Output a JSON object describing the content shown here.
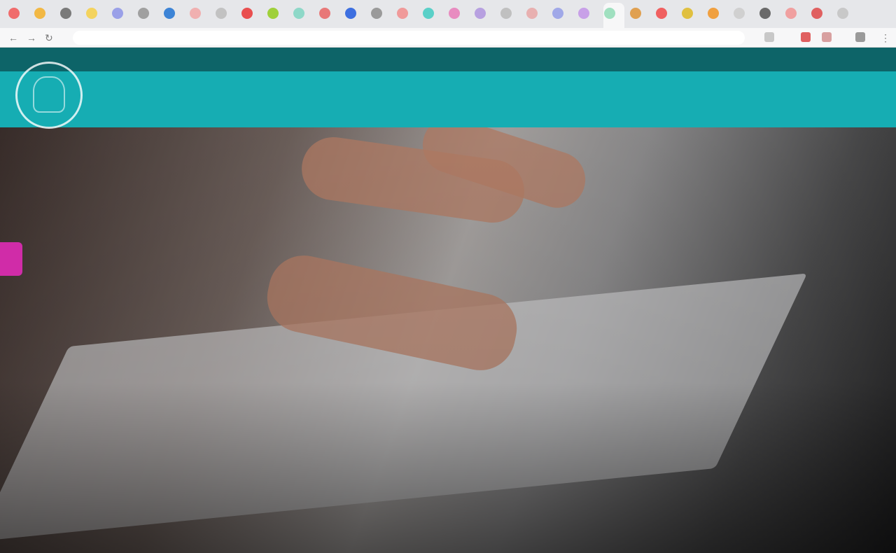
{
  "browser": {
    "tab_icon_colors": [
      "#f06c6c",
      "#f2b844",
      "#7a7a7a",
      "#f4d35e",
      "#9aa0e8",
      "#a0a0a0",
      "#3d84d6",
      "#f0b0b0",
      "#c2c2c2",
      "#e94f4f",
      "#9fd03a",
      "#8ed8c8",
      "#e87878",
      "#3d6fe0",
      "#9a9a9a",
      "#f09a9a",
      "#5ad0c8",
      "#e88cc0",
      "#b7a0e0",
      "#c0c0c0",
      "#e8b0b0",
      "#a0a8e8",
      "#c8a0e8",
      "#a0e0c0",
      "#e0a050",
      "#f06060",
      "#e0c040",
      "#f0a040",
      "#d0d0d0",
      "#6a6a6a",
      "#f0a0a0",
      "#e06060",
      "#c8c8c8"
    ],
    "address": ""
  },
  "site": {
    "topbar_links": [
      "",
      "",
      "",
      "",
      ""
    ],
    "nav_links": [
      "",
      "",
      "",
      "",
      ""
    ]
  },
  "hero": {
    "title_line1": "",
    "title_line2": "",
    "text": ""
  },
  "colors": {
    "topbar": "#0d6468",
    "nav": "#16adb3",
    "side_tab": "#d02ca8"
  }
}
